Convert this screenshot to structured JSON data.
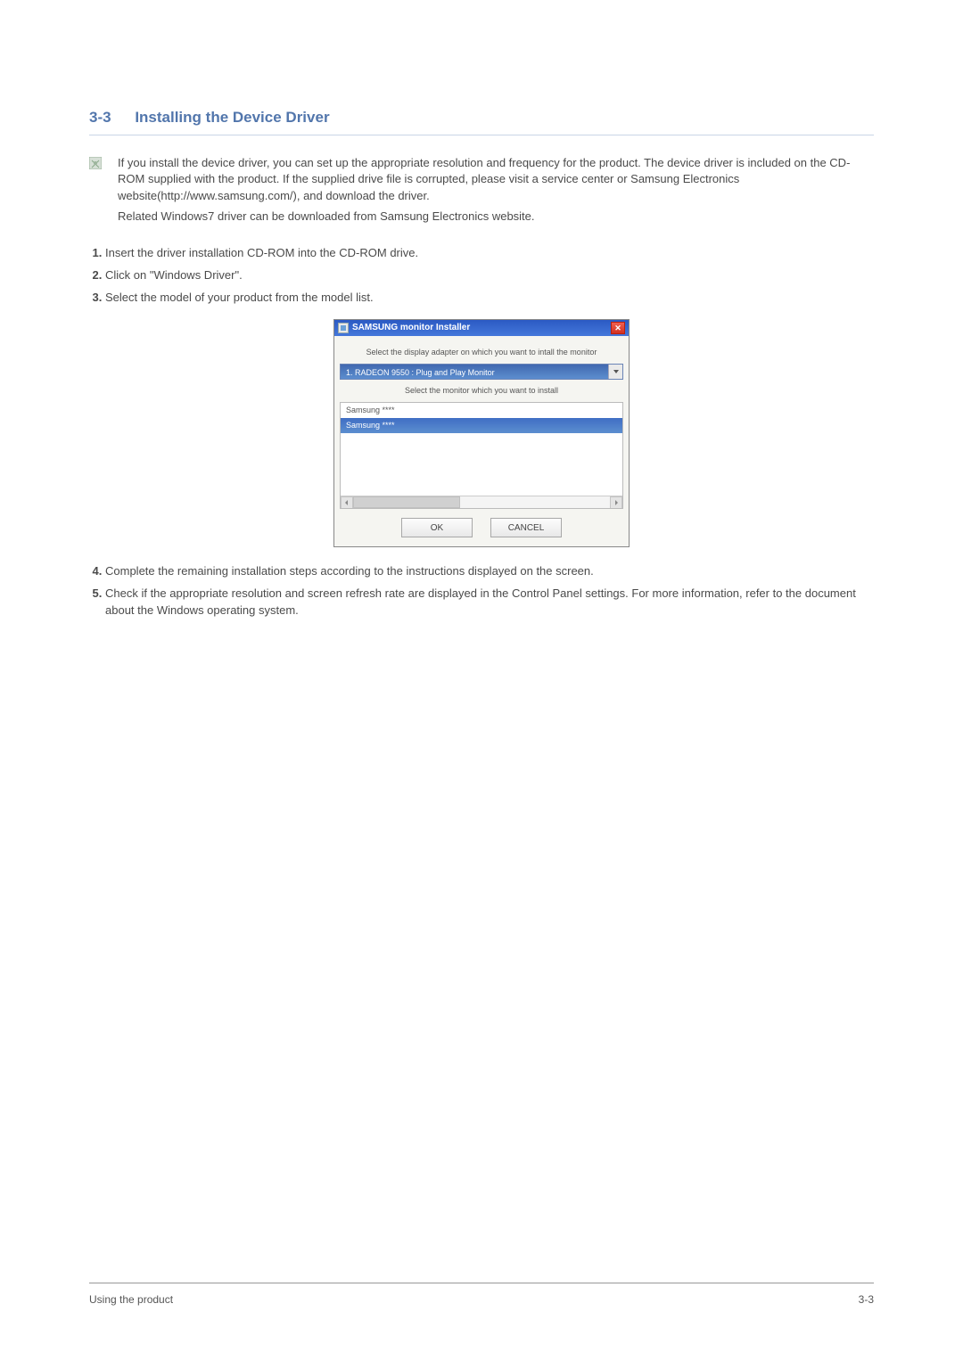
{
  "section": {
    "number": "3-3",
    "title": "Installing the Device Driver"
  },
  "info": {
    "p1": "If you install the device driver, you can set up the appropriate resolution and frequency for the product. The device driver is included on the CD-ROM supplied with the product. If the supplied drive file is corrupted, please visit a service center or Samsung Electronics website(http://www.samsung.com/), and download the driver.",
    "p2": "Related Windows7 driver can be downloaded from Samsung Electronics website."
  },
  "steps": [
    "Insert the driver installation CD-ROM into the CD-ROM drive.",
    "Click on \"Windows Driver\".",
    "Select the model of your product from the model list.",
    "Complete the remaining installation steps according to the instructions displayed on the screen.",
    "Check if the appropriate resolution and screen refresh rate are displayed in the Control Panel settings. For more information, refer to the document about the Windows operating system."
  ],
  "dialog": {
    "title": "SAMSUNG monitor Installer",
    "caption1": "Select the display adapter on which you want to intall the monitor",
    "adapter": "1. RADEON 9550 : Plug and Play Monitor",
    "caption2": "Select the monitor which you want to install",
    "items": [
      "Samsung ****",
      "Samsung ****"
    ],
    "ok": "OK",
    "cancel": "CANCEL"
  },
  "footer": {
    "left": "Using the product",
    "right": "3-3"
  }
}
